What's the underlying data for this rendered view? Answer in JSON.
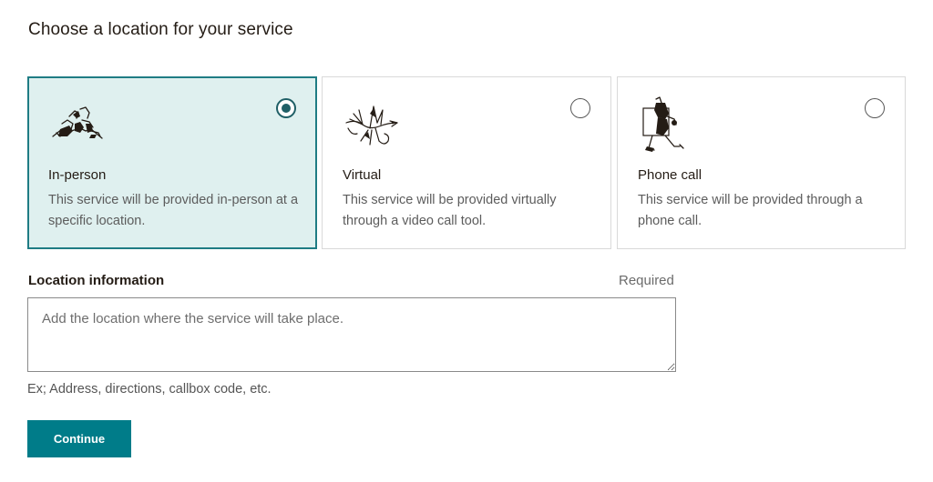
{
  "page": {
    "title": "Choose a location for your service"
  },
  "options": [
    {
      "label": "In-person",
      "description": "This service will be provided in-person at a specific location.",
      "selected": true,
      "icon": "in-person-illustration"
    },
    {
      "label": "Virtual",
      "description": "This service will be provided virtually through a video call tool.",
      "selected": false,
      "icon": "virtual-illustration"
    },
    {
      "label": "Phone call",
      "description": "This service will be provided through a phone call.",
      "selected": false,
      "icon": "phone-call-illustration"
    }
  ],
  "location_field": {
    "label": "Location information",
    "required_text": "Required",
    "placeholder": "Add the location where the service will take place.",
    "value": "",
    "hint": "Ex; Address, directions, callbox code, etc."
  },
  "actions": {
    "continue_label": "Continue"
  },
  "colors": {
    "accent": "#007c89",
    "selected_background": "#dff0ef",
    "selected_border": "#1f7c84",
    "text": "#241c15"
  }
}
